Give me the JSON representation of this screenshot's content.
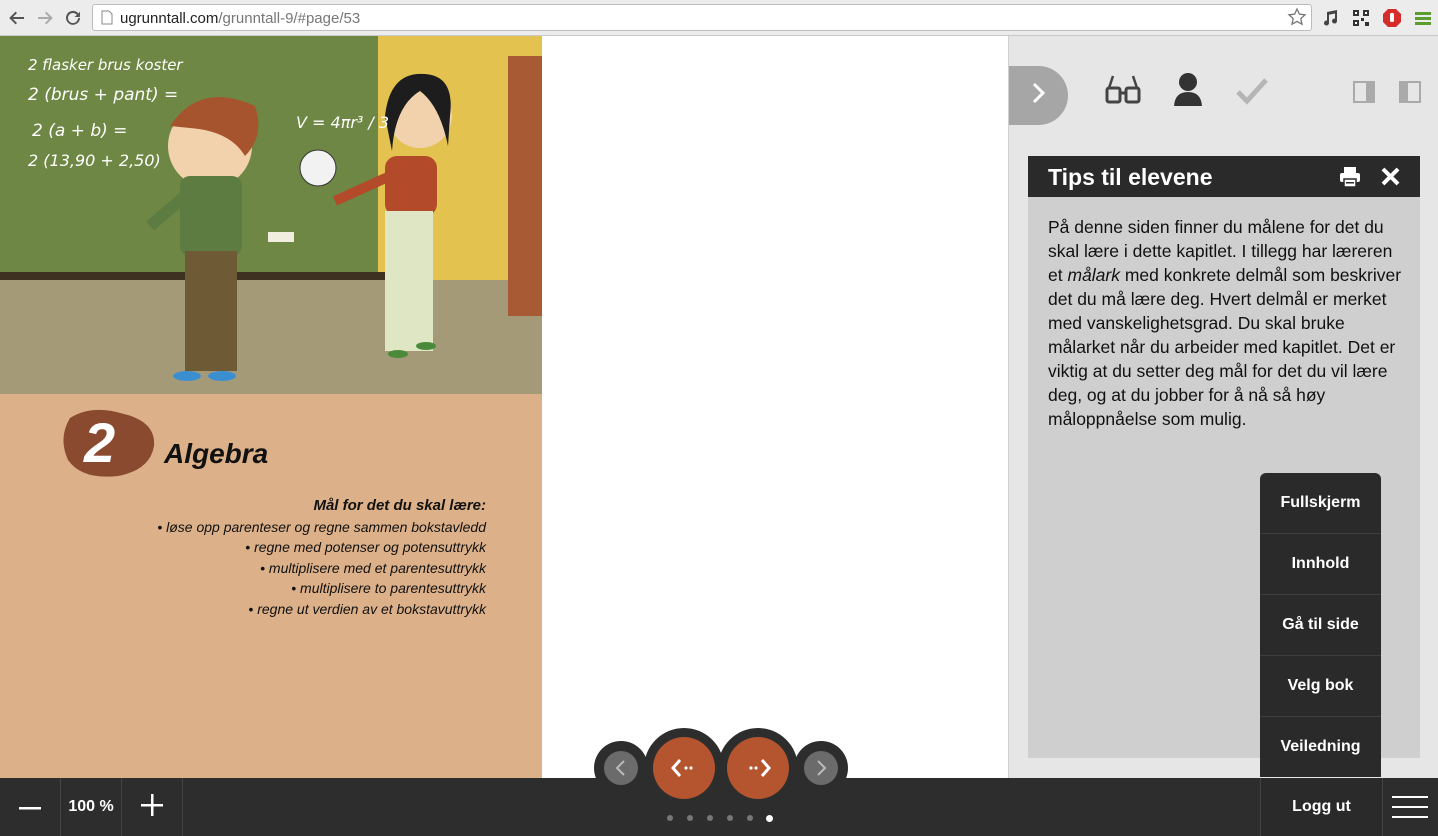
{
  "browser": {
    "url_host": "ugrunntall.com",
    "url_path": "/grunntall-9/#page/53"
  },
  "book": {
    "chapter_number": "2",
    "chapter_title": "Algebra",
    "goals_heading": "Mål for det du skal lære:",
    "goals": [
      "• løse opp parenteser og regne sammen bokstavledd",
      "• regne med potenser og potensuttrykk",
      "• multiplisere med et parentesuttrykk",
      "• multiplisere to parentesuttrykk",
      "• regne ut verdien av et bokstavuttrykk"
    ],
    "chalkboard": [
      "2 flasker brus koster",
      "2 (brus + pant) =",
      "2  (a + b) =",
      "2 (13,90 + 2,50)"
    ],
    "formula": "V = 4πr³ / 3"
  },
  "tips": {
    "title": "Tips til elevene",
    "body_part1": "På denne siden finner du målene for det du skal lære i dette kapitlet. I tillegg har læreren et ",
    "body_emph": "målark",
    "body_part2": " med konkrete delmål som beskriver det du må lære deg. Hvert delmål er merket med vanskelighetsgrad. Du skal bruke målarket når du arbeider med kapitlet. Det er viktig at du setter deg mål for det du vil lære deg, og at du jobber for å nå så høy måloppnåelse som mulig."
  },
  "menu": {
    "items": [
      "Fullskjerm",
      "Innhold",
      "Gå til side",
      "Velg bok",
      "Veiledning"
    ]
  },
  "bottombar": {
    "zoom": "100 %",
    "logout": "Logg ut"
  },
  "pager": {
    "page_dots": 6,
    "active_dot": 5
  },
  "colors": {
    "accent": "#b4552f",
    "page_bg": "#dcb088",
    "chapter_blob": "#8a4a30"
  },
  "icons": [
    "back-icon",
    "forward-icon",
    "reload-icon",
    "page-icon",
    "star-icon",
    "music-icon",
    "qr-icon",
    "adblock-icon",
    "menu-icon",
    "chevron-right-icon",
    "glasses-icon",
    "person-icon",
    "check-icon",
    "layout-single-icon",
    "layout-double-icon",
    "print-icon",
    "close-icon",
    "minus-icon",
    "plus-icon",
    "hamburger-icon"
  ]
}
